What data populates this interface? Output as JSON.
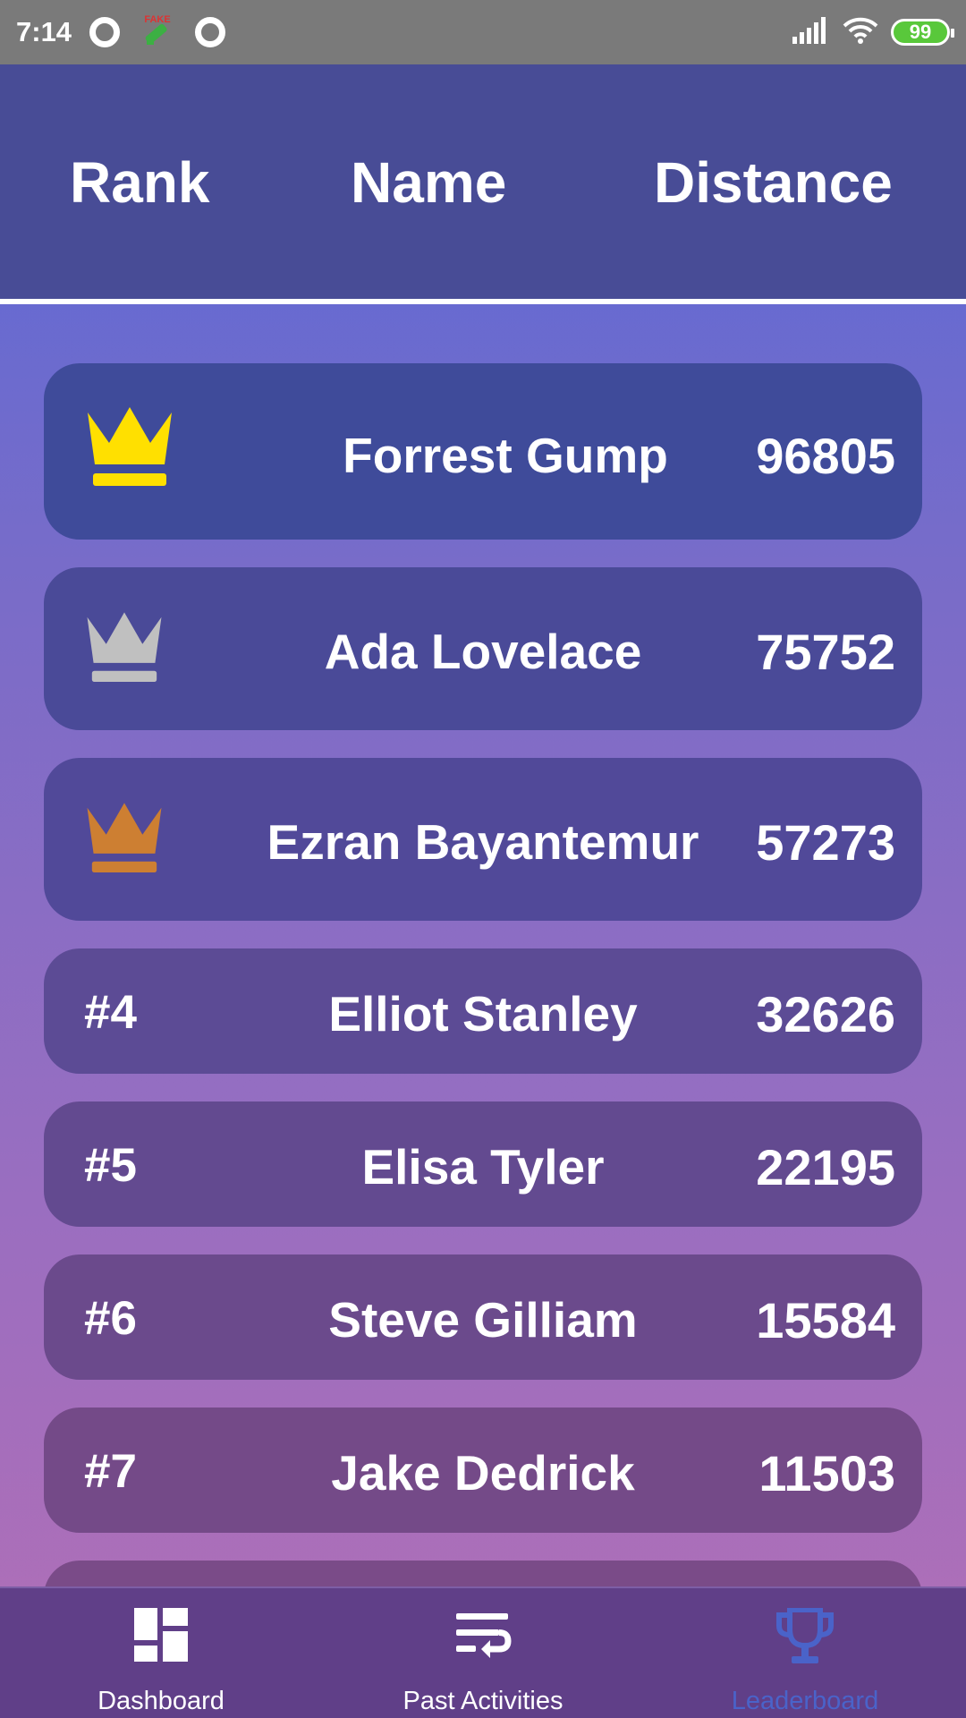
{
  "status_bar": {
    "time": "7:14",
    "fake_label": "FAKE",
    "battery": "99"
  },
  "header": {
    "rank": "Rank",
    "name": "Name",
    "distance": "Distance"
  },
  "leaderboard": [
    {
      "rank": "1",
      "name": "Forrest Gump",
      "distance": "96805",
      "crown": "gold-crown-icon",
      "crown_color": "#ffe000"
    },
    {
      "rank": "2",
      "name": "Ada Lovelace",
      "distance": "75752",
      "crown": "silver-crown-icon",
      "crown_color": "#c0c0c0"
    },
    {
      "rank": "3",
      "name": "Ezran Bayantemur",
      "distance": "57273",
      "crown": "bronze-crown-icon",
      "crown_color": "#cd7f32"
    },
    {
      "rank": "#4",
      "name": "Elliot  Stanley",
      "distance": "32626"
    },
    {
      "rank": "#5",
      "name": "Elisa  Tyler",
      "distance": "22195"
    },
    {
      "rank": "#6",
      "name": "Steve Gilliam",
      "distance": "15584"
    },
    {
      "rank": "#7",
      "name": "Jake Dedrick",
      "distance": "11503"
    }
  ],
  "bottom_nav": {
    "items": [
      {
        "label": "Dashboard",
        "icon": "dashboard-icon"
      },
      {
        "label": "Past Activities",
        "icon": "wrap-text-icon"
      },
      {
        "label": "Leaderboard",
        "icon": "trophy-icon",
        "active": true
      }
    ]
  },
  "colors": {
    "header_bg": "#484c96",
    "nav_bg": "#603f88",
    "active_nav": "#4a63c9",
    "gold": "#ffe000",
    "silver": "#c0c0c0",
    "bronze": "#cd7f32"
  }
}
